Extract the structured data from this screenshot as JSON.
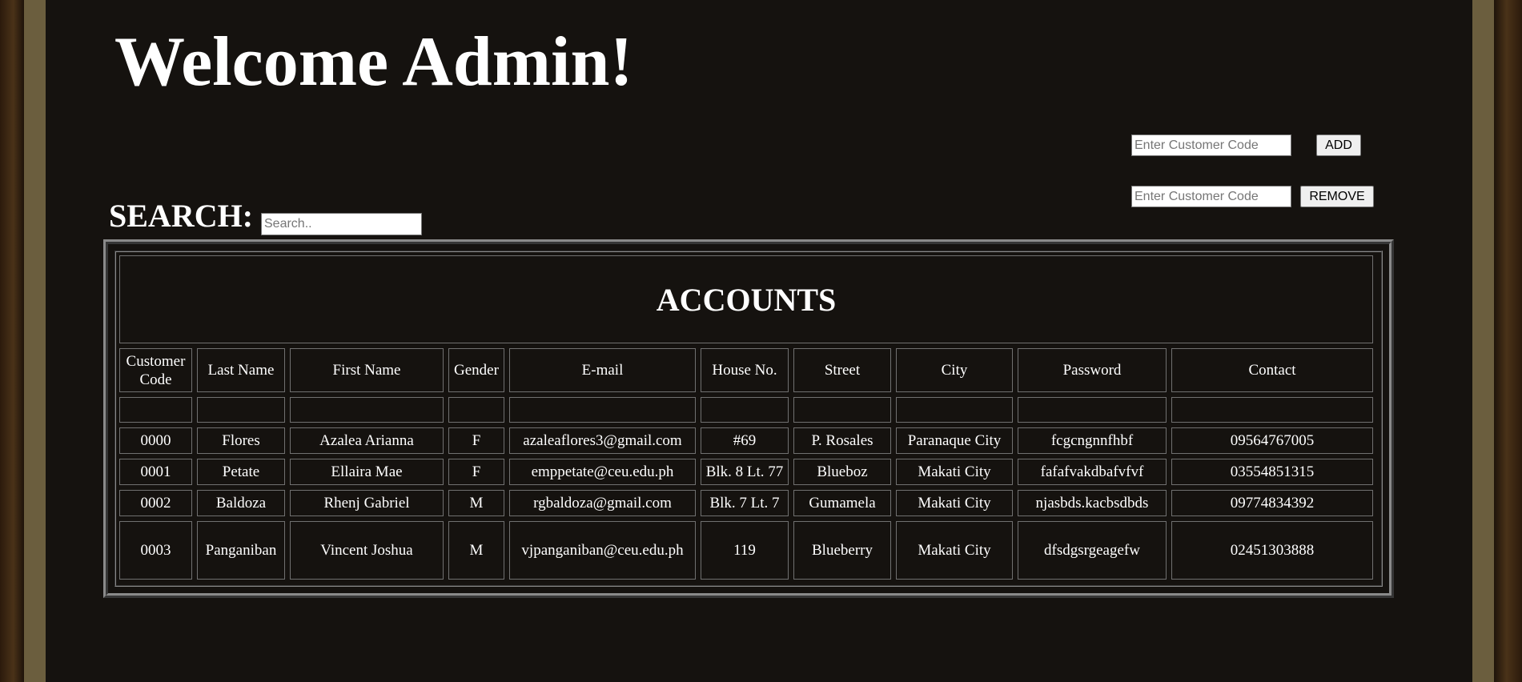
{
  "page": {
    "title": "Welcome Admin!"
  },
  "add_form": {
    "placeholder": "Enter Customer Code",
    "button_label": "ADD"
  },
  "remove_form": {
    "placeholder": "Enter Customer Code",
    "button_label": "REMOVE"
  },
  "search": {
    "label": "SEARCH:",
    "placeholder": "Search.."
  },
  "accounts": {
    "title": "ACCOUNTS",
    "columns": [
      "Customer Code",
      "Last Name",
      "First Name",
      "Gender",
      "E-mail",
      "House No.",
      "Street",
      "City",
      "Password",
      "Contact"
    ],
    "rows": [
      [
        "0000",
        "Flores",
        "Azalea Arianna",
        "F",
        "azaleaflores3@gmail.com",
        "#69",
        "P. Rosales",
        "Paranaque City",
        "fcgcngnnfhbf",
        "09564767005"
      ],
      [
        "0001",
        "Petate",
        "Ellaira Mae",
        "F",
        "emppetate@ceu.edu.ph",
        "Blk. 8 Lt. 77",
        "Blueboz",
        "Makati City",
        "fafafvakdbafvfvf",
        "03554851315"
      ],
      [
        "0002",
        "Baldoza",
        "Rhenj Gabriel",
        "M",
        "rgbaldoza@gmail.com",
        "Blk. 7 Lt. 7",
        "Gumamela",
        "Makati City",
        "njasbds.kacbsdbds",
        "09774834392"
      ],
      [
        "0003",
        "Panganiban",
        "Vincent Joshua",
        "M",
        "vjpanganiban@ceu.edu.ph",
        "119",
        "Blueberry",
        "Makati City",
        "dfsdgsrgeagefw",
        "02451303888"
      ]
    ]
  }
}
